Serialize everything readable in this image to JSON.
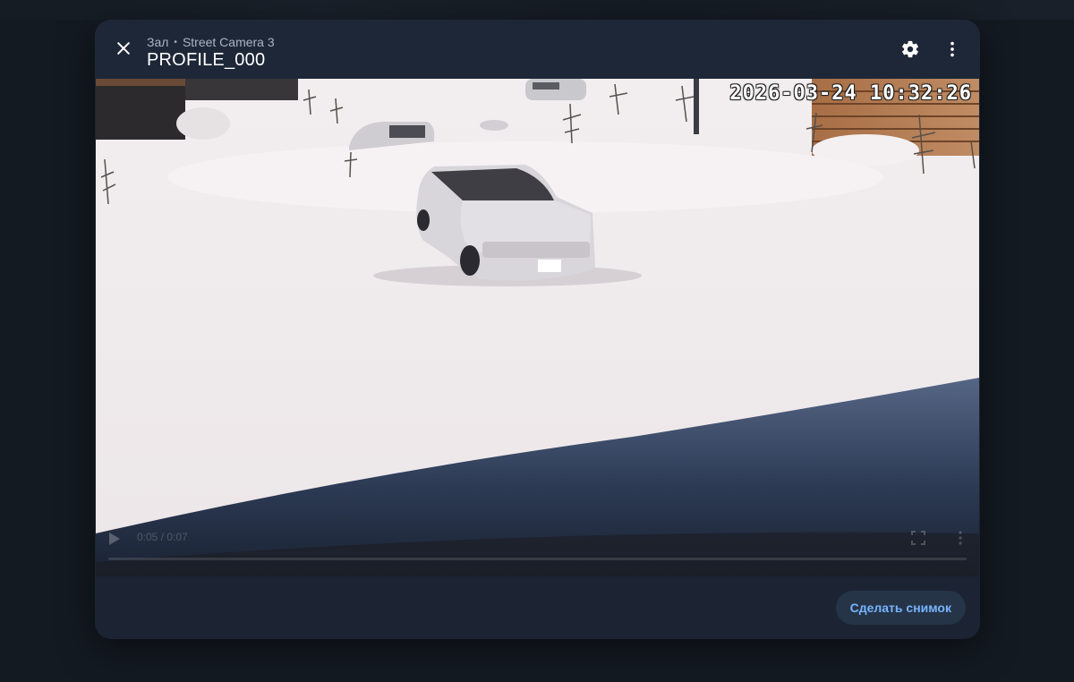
{
  "dialog": {
    "breadcrumb": {
      "area": "Зал",
      "camera": "Street Camera 3"
    },
    "title": "PROFILE_000",
    "icons": {
      "close": "close-icon",
      "settings": "gear-icon",
      "menu": "more-vertical-icon"
    }
  },
  "video": {
    "timestamp": "2026-03-24 10:32:26",
    "time_display": "0:05 / 0:07",
    "icons": {
      "play": "play-icon",
      "fullscreen": "fullscreen-icon",
      "menu": "more-vertical-icon"
    }
  },
  "footer": {
    "snapshot_label": "Сделать снимок"
  },
  "colors": {
    "dialog_bg": "#1c2433",
    "accent": "#78b4ff",
    "button_bg": "#253447"
  }
}
